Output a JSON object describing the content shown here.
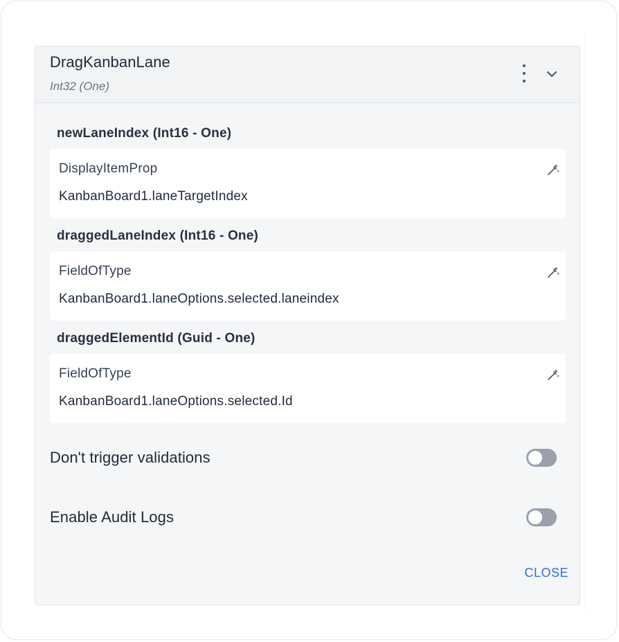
{
  "dialog": {
    "title": "DragKanbanLane",
    "subtitle": "Int32 (One)",
    "menu_icon": "more-vertical-icon",
    "collapse_icon": "chevron-down-icon"
  },
  "params": [
    {
      "label": "newLaneIndex (Int16 - One)",
      "type": "DisplayItemProp",
      "value": "KanbanBoard1.laneTargetIndex",
      "icon": "magic-wand-icon"
    },
    {
      "label": "draggedLaneIndex (Int16 - One)",
      "type": "FieldOfType",
      "value": "KanbanBoard1.laneOptions.selected.laneindex",
      "icon": "magic-wand-icon"
    },
    {
      "label": "draggedElementId (Guid - One)",
      "type": "FieldOfType",
      "value": "KanbanBoard1.laneOptions.selected.Id",
      "icon": "magic-wand-icon"
    }
  ],
  "toggles": [
    {
      "label": "Don't trigger validations",
      "enabled": false
    },
    {
      "label": "Enable Audit Logs",
      "enabled": false
    }
  ],
  "footer": {
    "close_label": "CLOSE"
  },
  "colors": {
    "accent": "#2f6fdd",
    "toggle_off": "#9aa1ad",
    "panel_bg": "#f5f6f8"
  }
}
